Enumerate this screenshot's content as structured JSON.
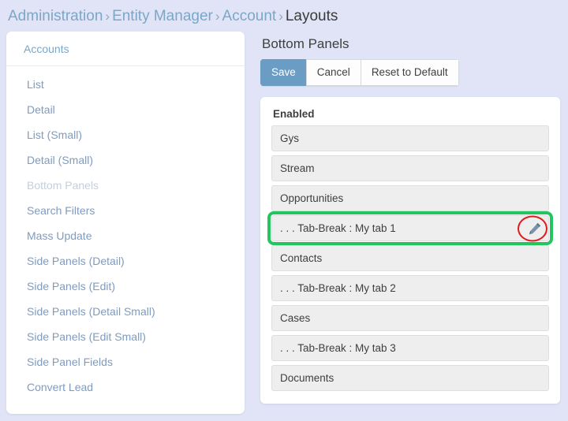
{
  "breadcrumb": {
    "separator": "›",
    "items": [
      {
        "label": "Administration",
        "current": false
      },
      {
        "label": "Entity Manager",
        "current": false
      },
      {
        "label": "Account",
        "current": false
      },
      {
        "label": "Layouts",
        "current": true
      }
    ]
  },
  "sidebar": {
    "header": "Accounts",
    "items": [
      {
        "label": "List",
        "active": false
      },
      {
        "label": "Detail",
        "active": false
      },
      {
        "label": "List (Small)",
        "active": false
      },
      {
        "label": "Detail (Small)",
        "active": false
      },
      {
        "label": "Bottom Panels",
        "active": true
      },
      {
        "label": "Search Filters",
        "active": false
      },
      {
        "label": "Mass Update",
        "active": false
      },
      {
        "label": "Side Panels (Detail)",
        "active": false
      },
      {
        "label": "Side Panels (Edit)",
        "active": false
      },
      {
        "label": "Side Panels (Detail Small)",
        "active": false
      },
      {
        "label": "Side Panels (Edit Small)",
        "active": false
      },
      {
        "label": "Side Panel Fields",
        "active": false
      },
      {
        "label": "Convert Lead",
        "active": false
      }
    ]
  },
  "main": {
    "title": "Bottom Panels",
    "buttons": [
      {
        "label": "Save",
        "primary": true
      },
      {
        "label": "Cancel",
        "primary": false
      },
      {
        "label": "Reset to Default",
        "primary": false
      }
    ],
    "panel": {
      "label": "Enabled",
      "rows": [
        {
          "label": "Gys",
          "highlighted": false,
          "has_edit_icon": false
        },
        {
          "label": "Stream",
          "highlighted": false,
          "has_edit_icon": false
        },
        {
          "label": "Opportunities",
          "highlighted": false,
          "has_edit_icon": false
        },
        {
          "label": ". . . Tab-Break : My tab 1",
          "highlighted": true,
          "has_edit_icon": true
        },
        {
          "label": "Contacts",
          "highlighted": false,
          "has_edit_icon": false
        },
        {
          "label": ". . . Tab-Break : My tab 2",
          "highlighted": false,
          "has_edit_icon": false
        },
        {
          "label": "Cases",
          "highlighted": false,
          "has_edit_icon": false
        },
        {
          "label": ". . . Tab-Break : My tab 3",
          "highlighted": false,
          "has_edit_icon": false
        },
        {
          "label": "Documents",
          "highlighted": false,
          "has_edit_icon": false
        }
      ]
    }
  },
  "annotations": {
    "highlight_box_color": "#22c55e",
    "ellipse_color": "#e01b1b"
  },
  "colors": {
    "page_background": "#e0e4f6",
    "card_background": "#ffffff",
    "primary_button": "#6b9cc4",
    "link_text": "#7ba7c7",
    "row_background": "#eeeeee"
  }
}
